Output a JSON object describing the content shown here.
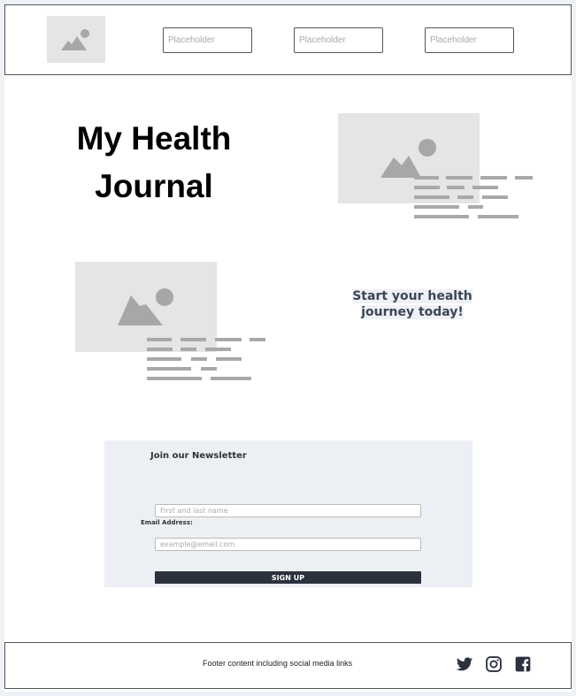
{
  "header": {
    "logo_icon": "image-placeholder-icon",
    "inputs": [
      {
        "placeholder": "Placeholder"
      },
      {
        "placeholder": "Placeholder"
      },
      {
        "placeholder": "Placeholder"
      }
    ]
  },
  "hero": {
    "title_line1": "My Health",
    "title_line2": "Journal",
    "image_icon": "image-placeholder-icon"
  },
  "feature": {
    "image_icon": "image-placeholder-icon",
    "cta_line1": "Start your health",
    "cta_line2": "journey today!"
  },
  "newsletter": {
    "title": "Join our Newsletter",
    "name_placeholder": "First and last name",
    "email_label": "Email Address:",
    "email_placeholder": "example@email.com",
    "button_label": "SIGN UP"
  },
  "footer": {
    "text": "Footer content including social media links",
    "social_icons": [
      "twitter-icon",
      "instagram-icon",
      "facebook-icon"
    ]
  },
  "colors": {
    "page_background": "#eef1f6",
    "placeholder_gray": "#e5e5e5",
    "button_dark": "#2b323e",
    "cta_text": "#3c4654"
  }
}
